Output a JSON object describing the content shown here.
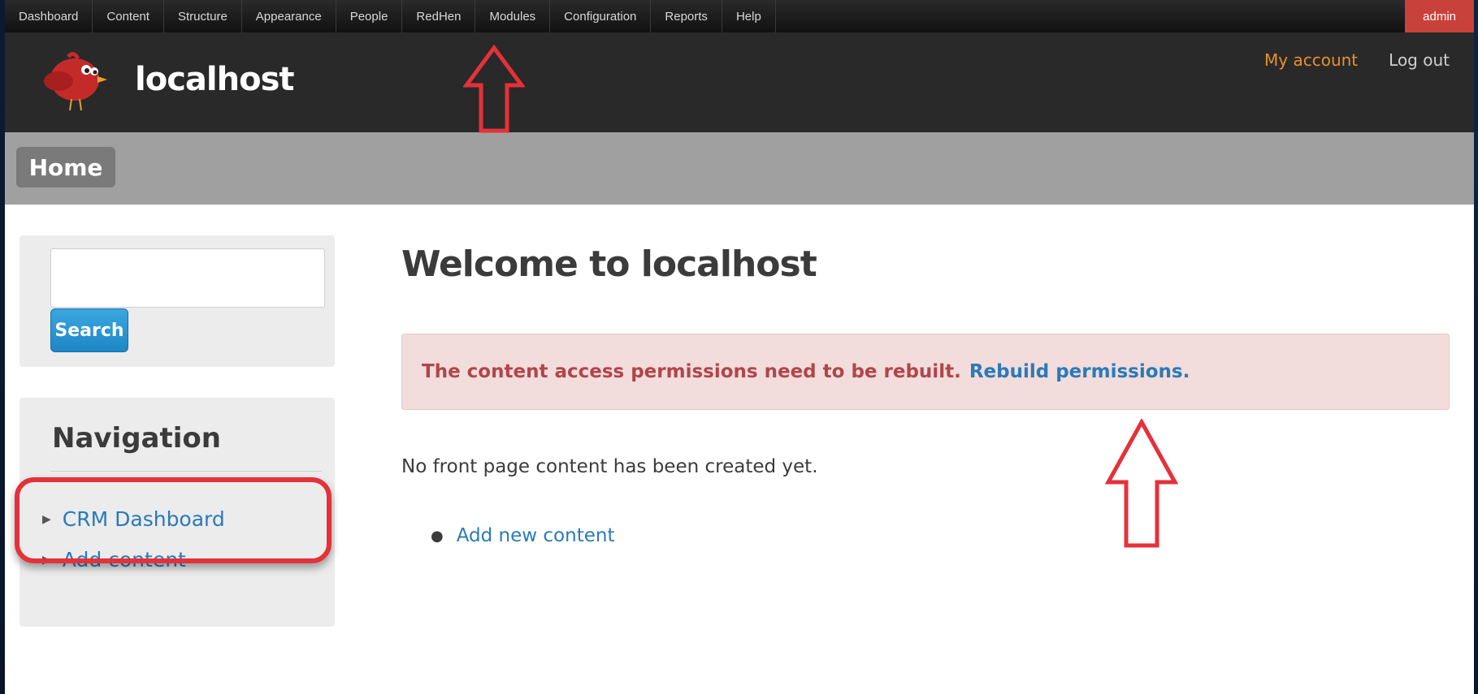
{
  "toolbar": {
    "items": [
      "Dashboard",
      "Content",
      "Structure",
      "Appearance",
      "People",
      "RedHen",
      "Modules",
      "Configuration",
      "Reports",
      "Help"
    ],
    "admin_label": "admin"
  },
  "header": {
    "site_name": "localhost",
    "my_account": "My account",
    "log_out": "Log out"
  },
  "main_menu": {
    "home": "Home"
  },
  "sidebar": {
    "search_button": "Search",
    "navigation_title": "Navigation",
    "nav_items": [
      "CRM Dashboard",
      "Add content"
    ]
  },
  "content": {
    "title": "Welcome to localhost",
    "message_text": "The content access permissions need to be rebuilt.",
    "message_link": "Rebuild permissions.",
    "empty_text": "No front page content has been created yet.",
    "add_new_content": "Add new content"
  },
  "colors": {
    "annotation_red": "#e4313a",
    "link_blue": "#2a7ab8",
    "error_bg": "#f3dcdc",
    "admin_red": "#c8413a"
  }
}
